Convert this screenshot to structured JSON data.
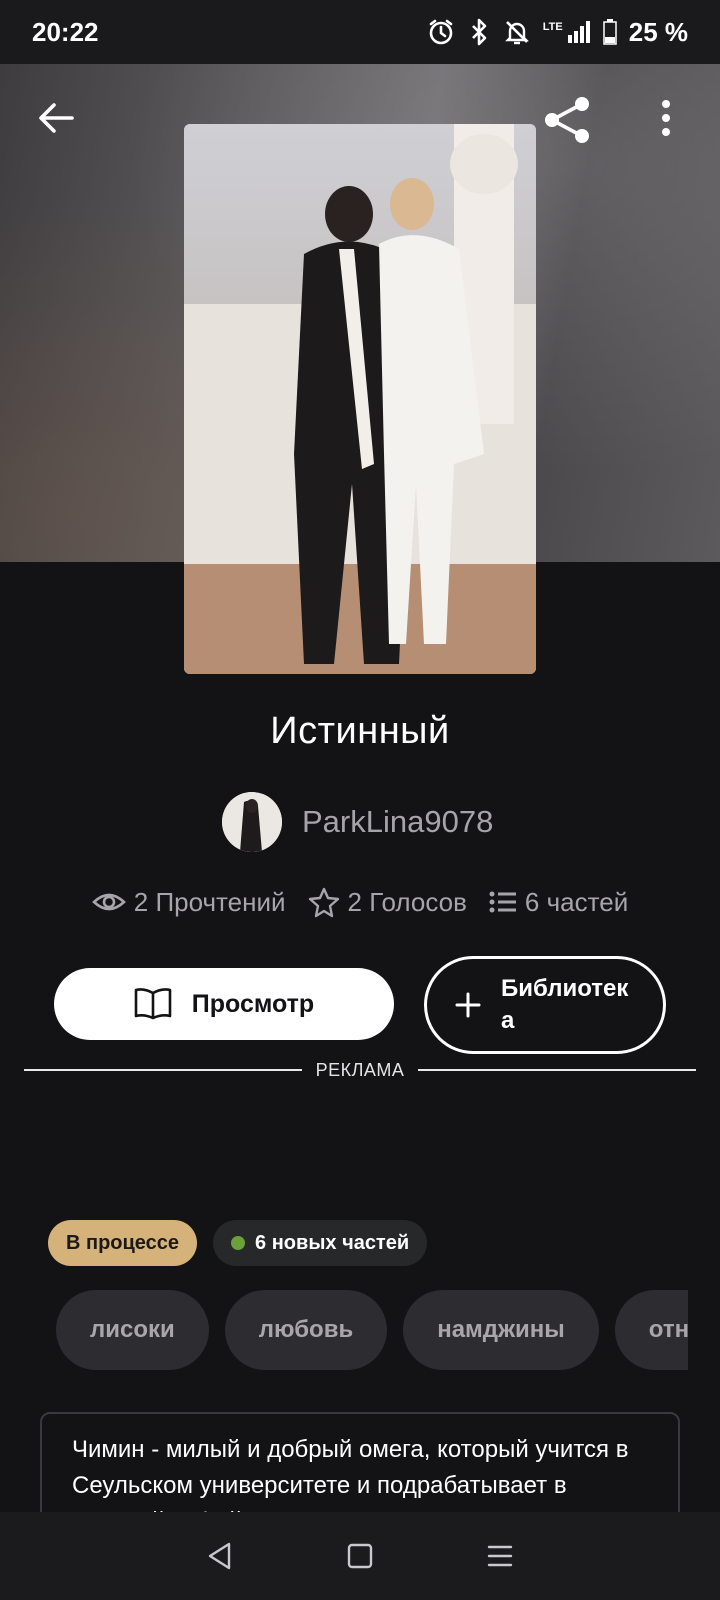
{
  "status_bar": {
    "time": "20:22",
    "network": "LTE",
    "battery": "25 %"
  },
  "header": {
    "back_icon": "arrow-left-icon",
    "share_icon": "share-icon",
    "more_icon": "more-vertical-icon"
  },
  "story": {
    "title": "Истинный",
    "author": "ParkLina9078",
    "stats": {
      "reads": "2 Прочтений",
      "votes": "2 Голосов",
      "parts": "6 частей"
    }
  },
  "actions": {
    "read_label": "Просмотр",
    "library_label": "Библиотека"
  },
  "ad": {
    "label": "РЕКЛАМА"
  },
  "badges": {
    "status": "В процессе",
    "new_parts": "6 новых частей"
  },
  "tags": [
    "лисоки",
    "любовь",
    "намджины",
    "отношения"
  ],
  "description": "Чимин - милый и добрый омега, который учится в Сеульском университете и подрабатывает в местной кофейне. Б",
  "colors": {
    "background": "#131215",
    "status_badge": "#d6b27b",
    "new_dot": "#6ca13a",
    "tag_bg": "#2d2c30"
  },
  "system_nav": {
    "back_icon": "nav-back-icon",
    "home_icon": "nav-home-icon",
    "recents_icon": "nav-recents-icon"
  }
}
